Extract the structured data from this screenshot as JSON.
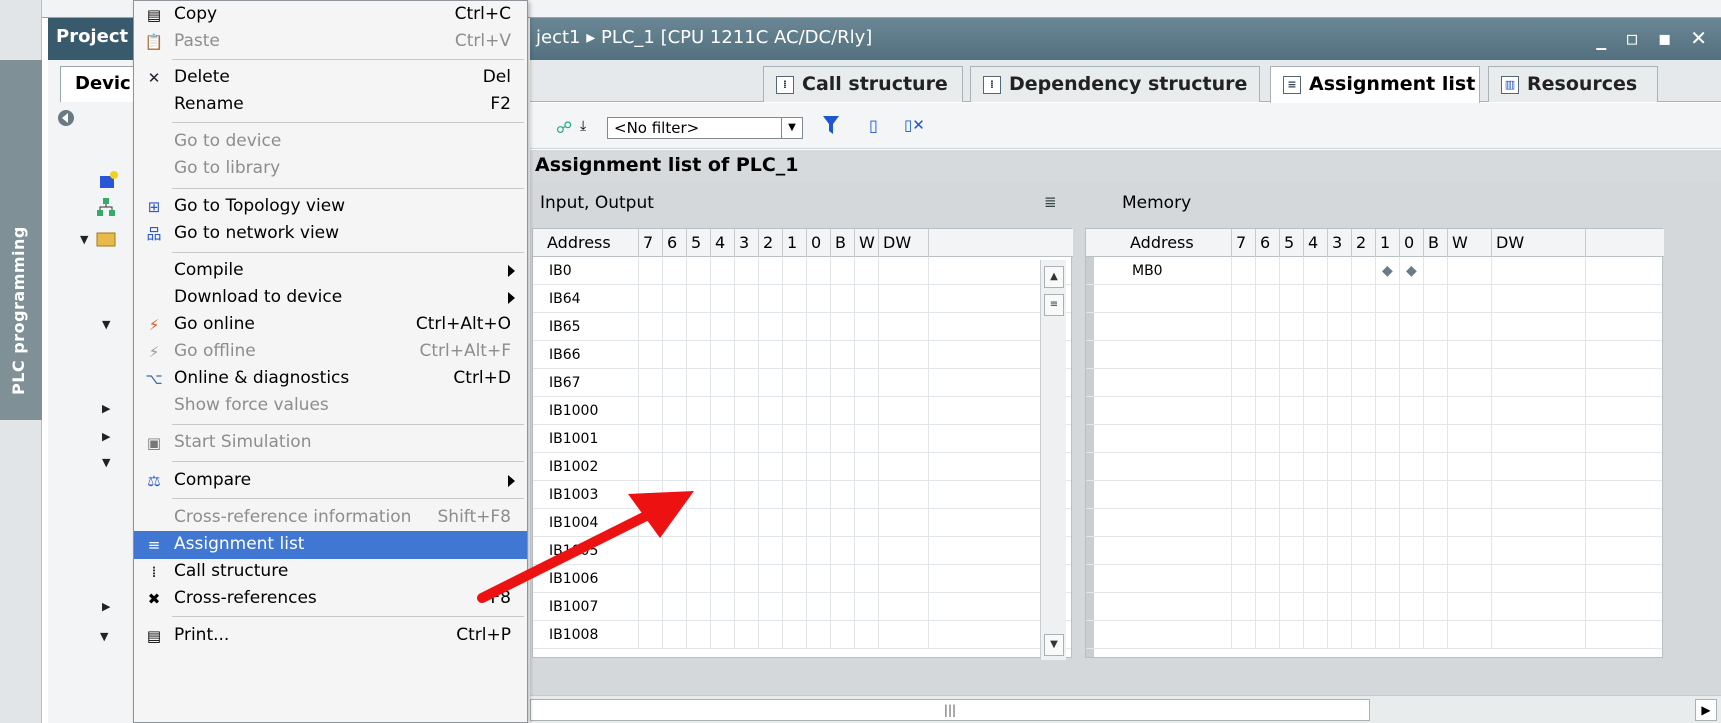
{
  "sidebar": {
    "vertical_tab_label": "PLC programming"
  },
  "project_pane": {
    "title": "Project",
    "tab_label": "Devic"
  },
  "editor": {
    "title": "ject1  ▸  PLC_1 [CPU 1211C AC/DC/Rly]",
    "window_controls": "_ ▫ ▪ ✕",
    "tabs": [
      {
        "label": "Call structure",
        "icon": "call-structure-icon",
        "active": false
      },
      {
        "label": "Dependency structure",
        "icon": "dependency-structure-icon",
        "active": false
      },
      {
        "label": "Assignment list",
        "icon": "assignment-list-icon",
        "active": true
      },
      {
        "label": "Resources",
        "icon": "resources-icon",
        "active": false
      }
    ],
    "filter_value": "<No filter>",
    "heading": "Assignment list of PLC_1"
  },
  "io_table": {
    "section_label": "Input, Output",
    "columns": [
      "Address",
      "7",
      "6",
      "5",
      "4",
      "3",
      "2",
      "1",
      "0",
      "B",
      "W",
      "DW"
    ],
    "rows": [
      "IB0",
      "IB64",
      "IB65",
      "IB66",
      "IB67",
      "IB1000",
      "IB1001",
      "IB1002",
      "IB1003",
      "IB1004",
      "IB1005",
      "IB1006",
      "IB1007",
      "IB1008"
    ]
  },
  "memory_table": {
    "section_label": "Memory",
    "columns": [
      "Address",
      "7",
      "6",
      "5",
      "4",
      "3",
      "2",
      "1",
      "0",
      "B",
      "W",
      "DW"
    ],
    "rows": [
      {
        "address": "MB0",
        "bit1": "◆",
        "bit0": "◆"
      }
    ]
  },
  "context_menu": {
    "items": [
      {
        "label": "Copy",
        "shortcut": "Ctrl+C",
        "icon": "copy-icon",
        "disabled": false
      },
      {
        "label": "Paste",
        "shortcut": "Ctrl+V",
        "icon": "paste-icon",
        "disabled": true
      },
      {
        "label": "Delete",
        "shortcut": "Del",
        "icon": "delete-icon",
        "disabled": false
      },
      {
        "label": "Rename",
        "shortcut": "F2",
        "disabled": false
      },
      {
        "label": "Go to device",
        "disabled": true
      },
      {
        "label": "Go to library",
        "disabled": true
      },
      {
        "label": "Go to Topology view",
        "icon": "topology-icon",
        "disabled": false
      },
      {
        "label": "Go to network view",
        "icon": "network-icon",
        "disabled": false
      },
      {
        "label": "Compile",
        "submenu": true,
        "disabled": false
      },
      {
        "label": "Download to device",
        "submenu": true,
        "disabled": false
      },
      {
        "label": "Go online",
        "shortcut": "Ctrl+Alt+O",
        "icon": "go-online-icon",
        "disabled": false
      },
      {
        "label": "Go offline",
        "shortcut": "Ctrl+Alt+F",
        "icon": "go-offline-icon",
        "disabled": true
      },
      {
        "label": "Online & diagnostics",
        "shortcut": "Ctrl+D",
        "icon": "diagnostics-icon",
        "disabled": false
      },
      {
        "label": "Show force values",
        "disabled": true
      },
      {
        "label": "Start Simulation",
        "icon": "simulation-icon",
        "disabled": true
      },
      {
        "label": "Compare",
        "icon": "compare-icon",
        "submenu": true,
        "disabled": false
      },
      {
        "label": "Cross-reference information",
        "shortcut": "Shift+F8",
        "disabled": true
      },
      {
        "label": "Assignment list",
        "icon": "assignment-list-icon",
        "highlighted": true
      },
      {
        "label": "Call structure",
        "icon": "call-structure-icon",
        "disabled": false
      },
      {
        "label": "Cross-references",
        "shortcut": "F8",
        "icon": "cross-references-icon",
        "disabled": false
      },
      {
        "label": "Print...",
        "shortcut": "Ctrl+P",
        "icon": "print-icon",
        "disabled": false
      }
    ]
  },
  "colors": {
    "highlight": "#3f77d2",
    "title_bar": "#52707f",
    "annotation_arrow": "#ee1111"
  }
}
